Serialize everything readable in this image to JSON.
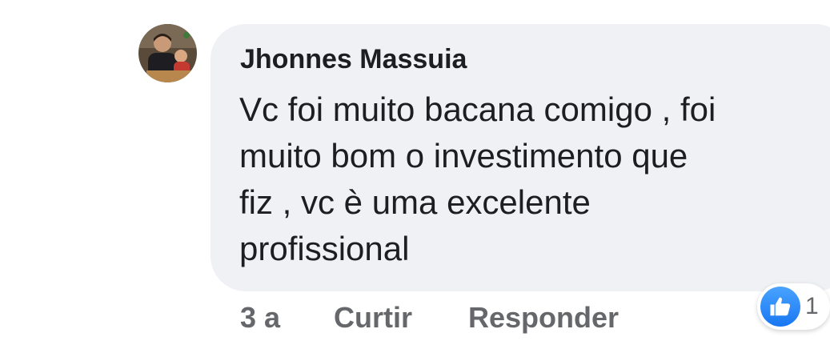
{
  "comment": {
    "author": "Jhonnes Massuia",
    "text_lines": [
      "Vc foi muito bacana comigo , foi",
      "muito bom o investimento que",
      "fiz , vc è uma excelente",
      "profissional"
    ],
    "timestamp": "3 a",
    "like_label": "Curtir",
    "reply_label": "Responder",
    "reaction": {
      "icon": "like-icon",
      "count": "1"
    }
  },
  "colors": {
    "bubble": "#eff1f5",
    "text": "#1c1e21",
    "secondary_text": "#65676b",
    "like_blue": "#1877f2"
  }
}
